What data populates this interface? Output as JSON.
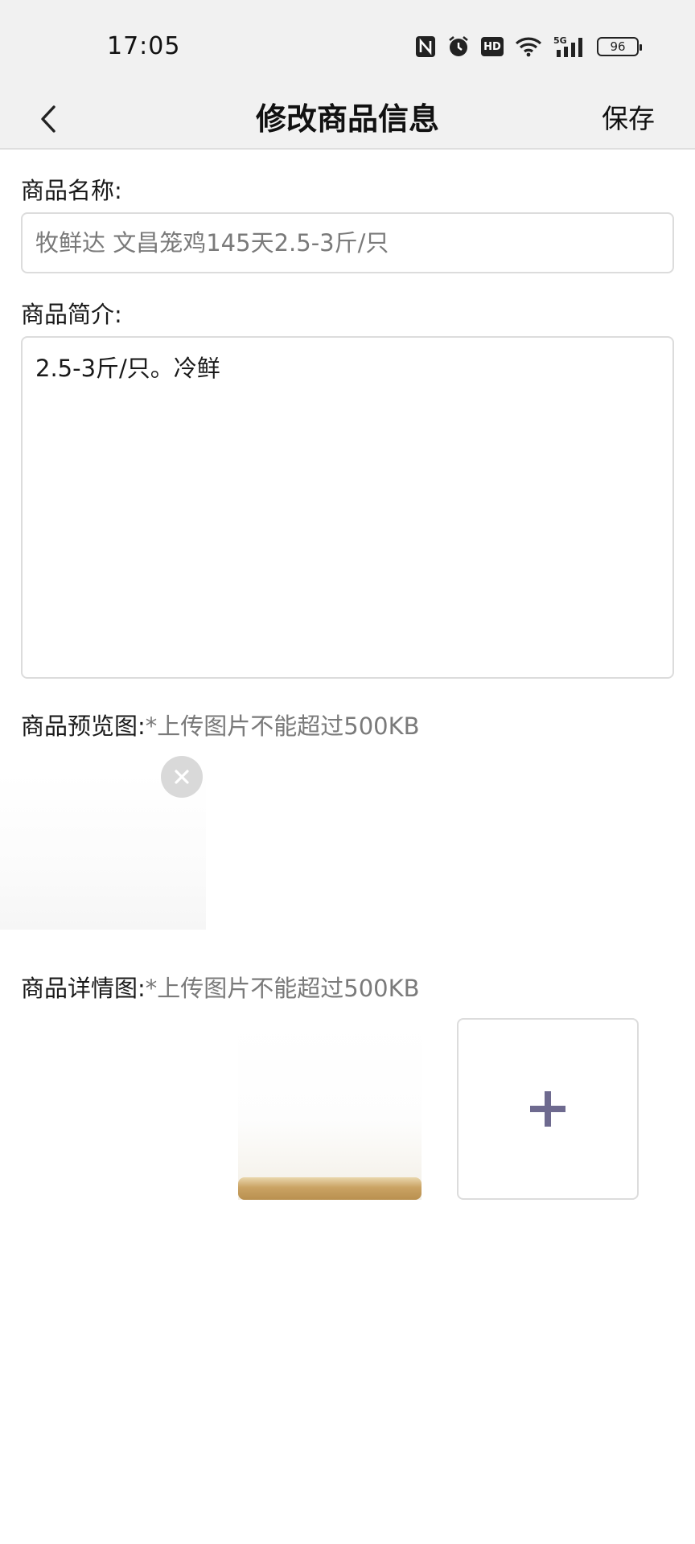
{
  "status_bar": {
    "time": "17:05",
    "battery": "96",
    "icons": [
      "nfc-icon",
      "alarm-icon",
      "hd-icon",
      "wifi-icon",
      "signal-5g-icon",
      "battery-icon"
    ],
    "hd_label": "HD",
    "network_label": "5G"
  },
  "nav": {
    "title": "修改商品信息",
    "save_label": "保存"
  },
  "form": {
    "name_label": "商品名称:",
    "name_value": "牧鲜达 文昌笼鸡145天2.5-3斤/只",
    "desc_label": "商品简介:",
    "desc_value": "2.5-3斤/只。冷鲜",
    "preview_label": "商品预览图:",
    "preview_hint": "*上传图片不能超过500KB",
    "detail_label": "商品详情图:",
    "detail_hint": "*上传图片不能超过500KB"
  },
  "colors": {
    "bar_bg": "#f1f1f1",
    "border": "#dcdcdc",
    "hint_text": "#7a7a7a",
    "add_icon": "#6e6a8f"
  }
}
